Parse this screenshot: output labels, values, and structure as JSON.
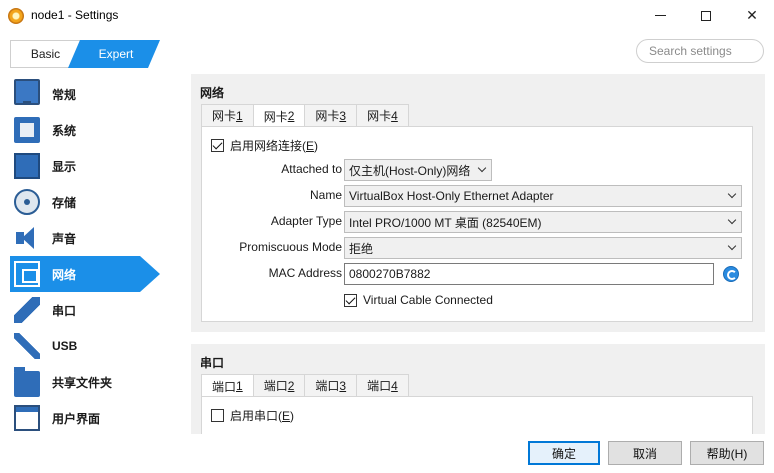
{
  "window": {
    "title": "node1 - Settings"
  },
  "mode": {
    "basic": "Basic",
    "expert": "Expert"
  },
  "search": {
    "placeholder": "Search settings"
  },
  "sidebar": {
    "items": [
      {
        "label": "常规",
        "icon": "monitor-icon"
      },
      {
        "label": "系统",
        "icon": "chip-icon"
      },
      {
        "label": "显示",
        "icon": "display-icon"
      },
      {
        "label": "存储",
        "icon": "disk-icon"
      },
      {
        "label": "声音",
        "icon": "speaker-icon"
      },
      {
        "label": "网络",
        "icon": "network-icon"
      },
      {
        "label": "串口",
        "icon": "serial-port-icon"
      },
      {
        "label": "USB",
        "icon": "usb-icon"
      },
      {
        "label": "共享文件夹",
        "icon": "folder-icon"
      },
      {
        "label": "用户界面",
        "icon": "window-icon"
      }
    ],
    "active_index": 5
  },
  "network": {
    "title": "网络",
    "tabs": [
      {
        "prefix": "网卡 ",
        "num": "1"
      },
      {
        "prefix": "网卡 ",
        "num": "2"
      },
      {
        "prefix": "网卡 ",
        "num": "3"
      },
      {
        "prefix": "网卡 ",
        "num": "4"
      }
    ],
    "active_tab": 1,
    "enable_label": "启用网络连接(",
    "enable_key": "E",
    "enable_suffix": ")",
    "enable_checked": true,
    "attached_label": "Attached to",
    "attached_value": "仅主机(Host-Only)网络",
    "name_label": "Name",
    "name_value": "VirtualBox Host-Only Ethernet Adapter",
    "adapter_label": "Adapter Type",
    "adapter_value": "Intel PRO/1000 MT 桌面 (82540EM)",
    "promisc_label": "Promiscuous Mode",
    "promisc_value": "拒绝",
    "mac_label": "MAC Address",
    "mac_value": "0800270B7882",
    "cable_label": "Virtual Cable Connected",
    "cable_checked": true
  },
  "serial": {
    "title": "串口",
    "tabs": [
      {
        "prefix": "端口 ",
        "num": "1"
      },
      {
        "prefix": "端口 ",
        "num": "2"
      },
      {
        "prefix": "端口 ",
        "num": "3"
      },
      {
        "prefix": "端口 ",
        "num": "4"
      }
    ],
    "active_tab": 0,
    "enable_label": "启用串口(",
    "enable_key": "E",
    "enable_suffix": ")",
    "enable_checked": false
  },
  "footer": {
    "ok": "确定",
    "cancel": "取消",
    "help": "帮助(H)"
  },
  "colors": {
    "accent": "#1b8fe8",
    "section_bg": "#f0f0f0"
  }
}
